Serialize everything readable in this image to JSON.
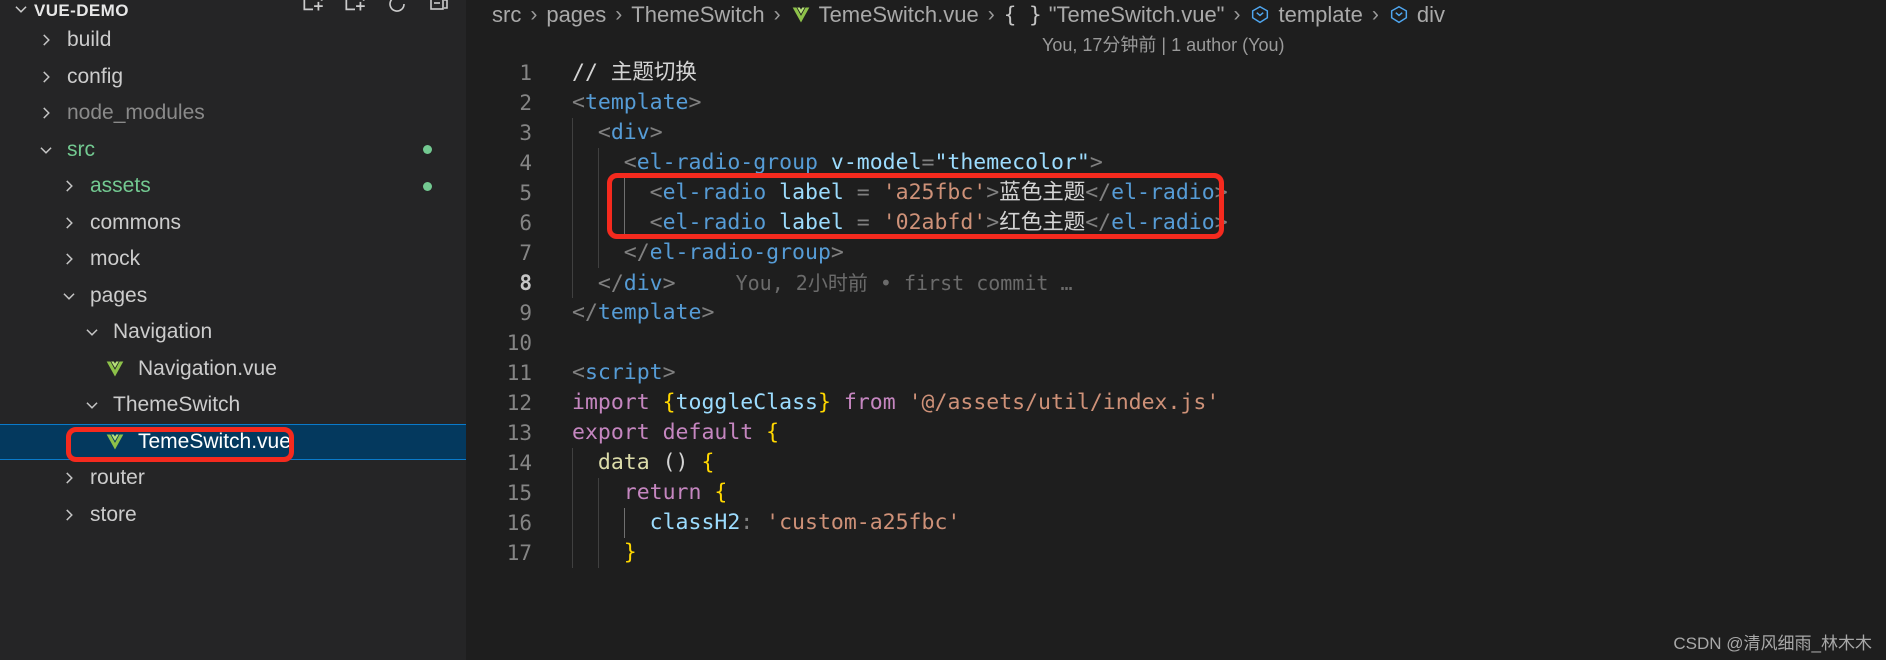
{
  "sidebar": {
    "header": {
      "title": "VUE-DEMO",
      "twisty": "chevron-down-icon",
      "actions": [
        "new-file-icon",
        "new-folder-icon",
        "refresh-icon",
        "collapse-all-icon"
      ]
    },
    "items": [
      {
        "label": "build",
        "indent": 1,
        "state": "collapsed",
        "kind": "folder",
        "tone": "normal"
      },
      {
        "label": "config",
        "indent": 1,
        "state": "collapsed",
        "kind": "folder",
        "tone": "normal"
      },
      {
        "label": "node_modules",
        "indent": 1,
        "state": "collapsed",
        "kind": "folder",
        "tone": "dim"
      },
      {
        "label": "src",
        "indent": 1,
        "state": "expanded",
        "kind": "folder",
        "tone": "green",
        "badge": "modified-dot"
      },
      {
        "label": "assets",
        "indent": 2,
        "state": "collapsed",
        "kind": "folder",
        "tone": "green",
        "badge": "modified-dot"
      },
      {
        "label": "commons",
        "indent": 2,
        "state": "collapsed",
        "kind": "folder",
        "tone": "normal"
      },
      {
        "label": "mock",
        "indent": 2,
        "state": "collapsed",
        "kind": "folder",
        "tone": "normal"
      },
      {
        "label": "pages",
        "indent": 2,
        "state": "expanded",
        "kind": "folder",
        "tone": "normal"
      },
      {
        "label": "Navigation",
        "indent": 3,
        "state": "expanded",
        "kind": "folder",
        "tone": "normal"
      },
      {
        "label": "Navigation.vue",
        "indent": 4,
        "state": "none",
        "kind": "vue",
        "tone": "normal"
      },
      {
        "label": "ThemeSwitch",
        "indent": 3,
        "state": "expanded",
        "kind": "folder",
        "tone": "normal"
      },
      {
        "label": "TemeSwitch.vue",
        "indent": 4,
        "state": "none",
        "kind": "vue",
        "tone": "normal",
        "selected": true
      },
      {
        "label": "router",
        "indent": 2,
        "state": "collapsed",
        "kind": "folder",
        "tone": "normal"
      },
      {
        "label": "store",
        "indent": 2,
        "state": "collapsed",
        "kind": "folder",
        "tone": "normal"
      }
    ]
  },
  "breadcrumb": [
    {
      "label": "src",
      "icon": "none"
    },
    {
      "label": "pages",
      "icon": "none"
    },
    {
      "label": "ThemeSwitch",
      "icon": "none"
    },
    {
      "label": "TemeSwitch.vue",
      "icon": "vue-icon"
    },
    {
      "label": "\"TemeSwitch.vue\"",
      "icon": "braces-icon"
    },
    {
      "label": "template",
      "icon": "symbol-field-icon"
    },
    {
      "label": "div",
      "icon": "symbol-field-icon"
    }
  ],
  "editor": {
    "blame_top": "You, 17分钟前 | 1 author (You)",
    "blame_inline_line8": "You, 2小时前 • first commit …",
    "current_line": 8,
    "lines": [
      {
        "n": "1",
        "tokens": [
          {
            "t": "// 主题切换",
            "c": "t-cmt"
          }
        ]
      },
      {
        "n": "2",
        "tokens": [
          {
            "t": "<",
            "c": "t-punct"
          },
          {
            "t": "template",
            "c": "t-tag"
          },
          {
            "t": ">",
            "c": "t-punct"
          }
        ]
      },
      {
        "n": "3",
        "tokens": [
          {
            "t": "  <",
            "c": "t-punct"
          },
          {
            "t": "div",
            "c": "t-tag"
          },
          {
            "t": ">",
            "c": "t-punct"
          }
        ]
      },
      {
        "n": "4",
        "tokens": [
          {
            "t": "    <",
            "c": "t-punct"
          },
          {
            "t": "el-radio-group",
            "c": "t-tag"
          },
          {
            "t": " ",
            "c": "t-txt"
          },
          {
            "t": "v-model",
            "c": "t-attr"
          },
          {
            "t": "=",
            "c": "t-punct"
          },
          {
            "t": "\"themecolor\"",
            "c": "t-attr"
          },
          {
            "t": ">",
            "c": "t-punct"
          }
        ]
      },
      {
        "n": "5",
        "tokens": [
          {
            "t": "      <",
            "c": "t-punct"
          },
          {
            "t": "el-radio",
            "c": "t-tag"
          },
          {
            "t": " ",
            "c": "t-txt"
          },
          {
            "t": "label",
            "c": "t-attr"
          },
          {
            "t": " = ",
            "c": "t-punct"
          },
          {
            "t": "'a25fbc'",
            "c": "t-str"
          },
          {
            "t": ">",
            "c": "t-punct"
          },
          {
            "t": "蓝色主题",
            "c": "t-txt"
          },
          {
            "t": "</",
            "c": "t-punct"
          },
          {
            "t": "el-radio",
            "c": "t-tag"
          },
          {
            "t": ">",
            "c": "t-punct"
          }
        ]
      },
      {
        "n": "6",
        "tokens": [
          {
            "t": "      <",
            "c": "t-punct"
          },
          {
            "t": "el-radio",
            "c": "t-tag"
          },
          {
            "t": " ",
            "c": "t-txt"
          },
          {
            "t": "label",
            "c": "t-attr"
          },
          {
            "t": " = ",
            "c": "t-punct"
          },
          {
            "t": "'02abfd'",
            "c": "t-str"
          },
          {
            "t": ">",
            "c": "t-punct"
          },
          {
            "t": "红色主题",
            "c": "t-txt"
          },
          {
            "t": "</",
            "c": "t-punct"
          },
          {
            "t": "el-radio",
            "c": "t-tag"
          },
          {
            "t": ">",
            "c": "t-punct"
          }
        ]
      },
      {
        "n": "7",
        "tokens": [
          {
            "t": "    </",
            "c": "t-punct"
          },
          {
            "t": "el-radio-group",
            "c": "t-tag"
          },
          {
            "t": ">",
            "c": "t-punct"
          }
        ]
      },
      {
        "n": "8",
        "tokens": [
          {
            "t": "  </",
            "c": "t-punct"
          },
          {
            "t": "div",
            "c": "t-tag"
          },
          {
            "t": ">",
            "c": "t-punct"
          }
        ],
        "blame": true
      },
      {
        "n": "9",
        "tokens": [
          {
            "t": "</",
            "c": "t-punct"
          },
          {
            "t": "template",
            "c": "t-tag"
          },
          {
            "t": ">",
            "c": "t-punct"
          }
        ]
      },
      {
        "n": "10",
        "tokens": []
      },
      {
        "n": "11",
        "tokens": [
          {
            "t": "<",
            "c": "t-punct"
          },
          {
            "t": "script",
            "c": "t-tag"
          },
          {
            "t": ">",
            "c": "t-punct"
          }
        ]
      },
      {
        "n": "12",
        "tokens": [
          {
            "t": "import",
            "c": "t-kw"
          },
          {
            "t": " ",
            "c": "t-txt"
          },
          {
            "t": "{",
            "c": "t-brace"
          },
          {
            "t": "toggleClass",
            "c": "t-prop"
          },
          {
            "t": "}",
            "c": "t-brace"
          },
          {
            "t": " ",
            "c": "t-txt"
          },
          {
            "t": "from",
            "c": "t-kw"
          },
          {
            "t": " ",
            "c": "t-txt"
          },
          {
            "t": "'@/assets/util/index.js'",
            "c": "t-str"
          }
        ]
      },
      {
        "n": "13",
        "tokens": [
          {
            "t": "export default",
            "c": "t-kw"
          },
          {
            "t": " ",
            "c": "t-txt"
          },
          {
            "t": "{",
            "c": "t-brace"
          }
        ]
      },
      {
        "n": "14",
        "tokens": [
          {
            "t": "  ",
            "c": "t-txt"
          },
          {
            "t": "data",
            "c": "t-fn"
          },
          {
            "t": " () ",
            "c": "t-txt"
          },
          {
            "t": "{",
            "c": "t-brace"
          }
        ]
      },
      {
        "n": "15",
        "tokens": [
          {
            "t": "    ",
            "c": "t-txt"
          },
          {
            "t": "return",
            "c": "t-kw"
          },
          {
            "t": " ",
            "c": "t-txt"
          },
          {
            "t": "{",
            "c": "t-brace"
          }
        ]
      },
      {
        "n": "16",
        "tokens": [
          {
            "t": "      ",
            "c": "t-txt"
          },
          {
            "t": "classH2",
            "c": "t-prop"
          },
          {
            "t": ": ",
            "c": "t-punct"
          },
          {
            "t": "'custom-a25fbc'",
            "c": "t-str"
          }
        ]
      },
      {
        "n": "17",
        "tokens": [
          {
            "t": "    ",
            "c": "t-txt"
          },
          {
            "t": "}",
            "c": "t-brace"
          }
        ]
      }
    ]
  },
  "annotations": {
    "code_box_color": "#f52a1e",
    "file_box_color": "#f52a1e"
  },
  "watermark": "CSDN @清风细雨_林木木",
  "colors": {
    "selection_bg": "#04395e",
    "selection_border": "#0a7aca",
    "folder_green": "#73c991",
    "editor_bg": "#1e1e1e",
    "sidebar_bg": "#252526"
  }
}
